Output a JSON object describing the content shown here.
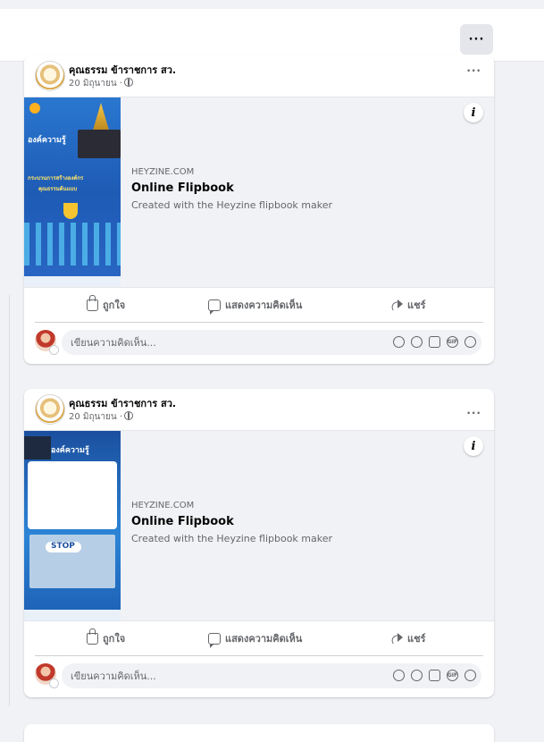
{
  "topbar": {
    "more_label": "···"
  },
  "posts": [
    {
      "page_name": "คุณธรรม ข้าราชการ สว.",
      "date": "20 มิถุนายน ·",
      "more_label": "···",
      "info_label": "i",
      "link": {
        "domain": "HEYZINE.COM",
        "title": "Online Flipbook",
        "description": "Created with the Heyzine flipbook maker"
      },
      "thumb_texts": [
        "องค์ความรู้",
        "กระบวนการสร้างองค์กร",
        "คุณธรรมต้นแบบ"
      ],
      "actions": {
        "like": "ถูกใจ",
        "comment": "แสดงความคิดเห็น",
        "share": "แชร์"
      },
      "comment_placeholder": "เขียนความคิดเห็น..."
    },
    {
      "page_name": "คุณธรรม ข้าราชการ สว.",
      "date": "20 มิถุนายน ·",
      "more_label": "···",
      "info_label": "i",
      "link": {
        "domain": "HEYZINE.COM",
        "title": "Online Flipbook",
        "description": "Created with the Heyzine flipbook maker"
      },
      "thumb_texts": [
        "องค์ความรู้",
        "STOP"
      ],
      "actions": {
        "like": "ถูกใจ",
        "comment": "แสดงความคิดเห็น",
        "share": "แชร์"
      },
      "comment_placeholder": "เขียนความคิดเห็น..."
    }
  ],
  "comment_tools": [
    "avatar-sticker-icon",
    "emoji-icon",
    "camera-icon",
    "gif-icon",
    "sticker-icon"
  ],
  "gif_label": "GIF",
  "colors": {
    "secondary_text": "#65676b",
    "background": "#f0f2f5",
    "card": "#ffffff"
  }
}
